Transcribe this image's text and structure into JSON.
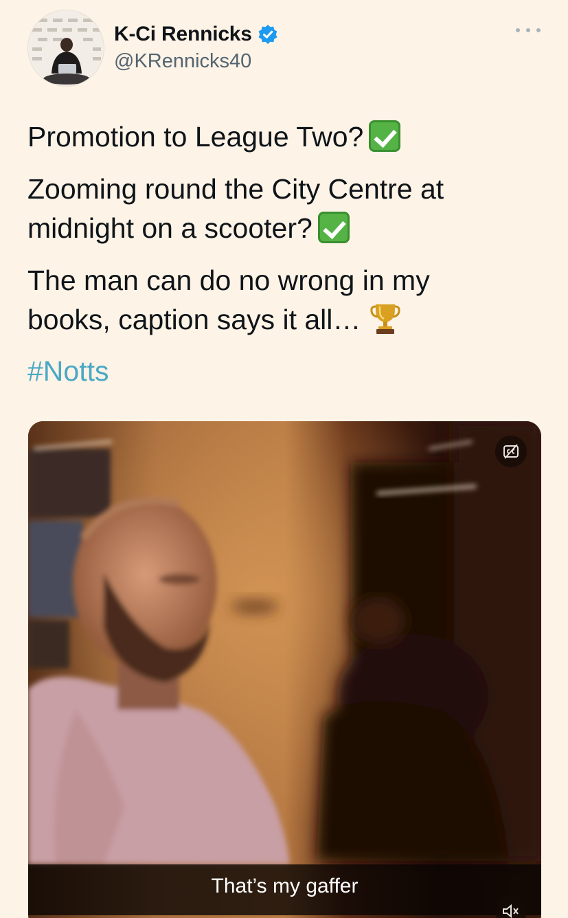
{
  "author": {
    "display_name": "K-Ci Rennicks",
    "handle": "@KRennicks40",
    "verified": true
  },
  "tweet": {
    "line1": "Promotion to League Two?",
    "line2a": "Zooming round the City Centre at",
    "line2b": "midnight on a scooter?",
    "line3a": "The man can do no wrong in my",
    "line3b": "books, caption says it all…",
    "hashtag": "#Notts"
  },
  "media": {
    "type": "video",
    "caption": "That’s my gaffer"
  },
  "icons": {
    "check": "check-mark-button-emoji",
    "trophy": "trophy-emoji",
    "more": "more-options-icon",
    "cc": "closed-captions-icon",
    "mute": "muted-speaker-icon",
    "verified": "verified-badge-icon"
  },
  "colors": {
    "background": "#fdf3e6",
    "hashtag": "#4aa8c5",
    "verified": "#1d9bf0",
    "check_green": "#55b346"
  }
}
